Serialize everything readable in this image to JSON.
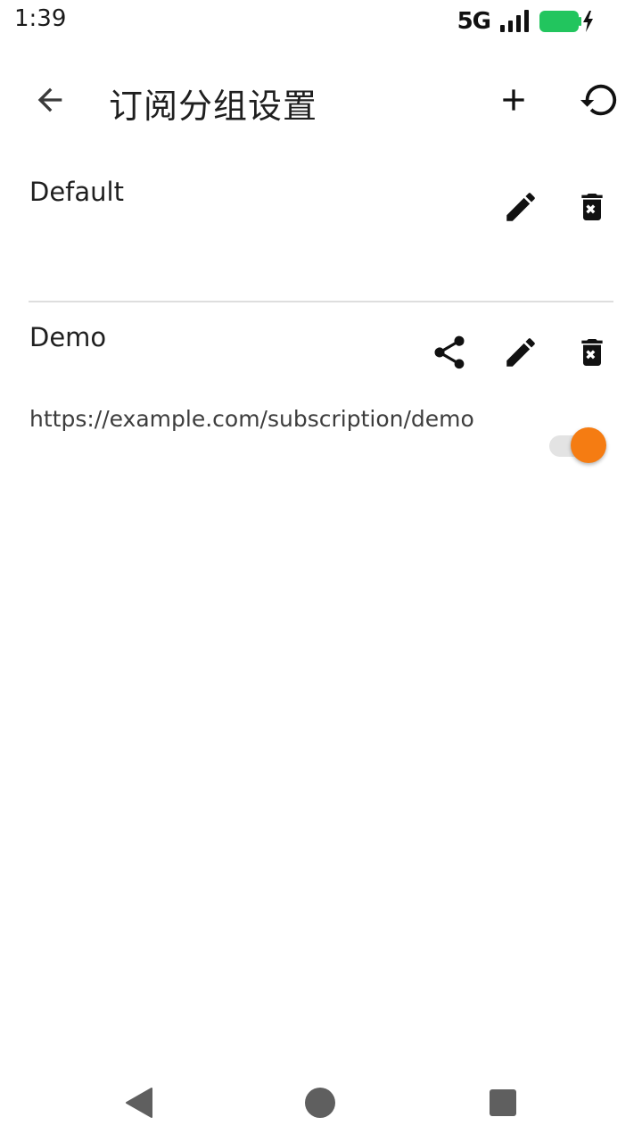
{
  "status_bar": {
    "time": "1:39",
    "network": "5G",
    "battery_color": "#22c55e",
    "icons": [
      "signal-icon",
      "battery-charging-icon"
    ]
  },
  "app_bar": {
    "title": "订阅分组设置",
    "icons": [
      "arrow-back-icon",
      "plus-icon",
      "refresh-icon"
    ]
  },
  "groups": [
    {
      "name": "Default",
      "url": "",
      "actions": [
        "edit-icon",
        "delete-icon"
      ]
    },
    {
      "name": "Demo",
      "url": "https://example.com/subscription/demo",
      "actions": [
        "share-icon",
        "edit-icon",
        "delete-icon"
      ],
      "enabled": true
    }
  ],
  "colors": {
    "accent": "#f57c12",
    "divider": "#dedede",
    "icon": "#111111"
  },
  "nav_bar": {
    "icons": [
      "nav-back-icon",
      "nav-home-icon",
      "nav-recents-icon"
    ]
  }
}
